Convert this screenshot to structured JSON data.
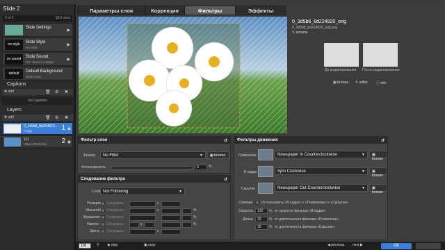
{
  "left": {
    "slide_title": "Slide 2",
    "slide_count": "2 of 2",
    "slide_duration": "10.0 secs",
    "buttons": [
      {
        "thumb": "",
        "title": "Slide Settings",
        "sub": ""
      },
      {
        "thumb": "no style",
        "title": "Slide Style",
        "sub": "No Style"
      },
      {
        "thumb": "no sound",
        "title": "Slide Sound",
        "sub": "Нет звука в слайде"
      },
      {
        "thumb": "default",
        "title": "Default Background",
        "sub": "Solid Color"
      }
    ],
    "captions_title": "Captions",
    "captions_add": "add",
    "no_captions": "No Captions",
    "layers_title": "Layers",
    "layers_add": "add",
    "layers": [
      {
        "name": "0_3d5b8_8d224820...",
        "type": "Image",
        "num": "1"
      },
      {
        "name": "111",
        "type": "Video (00:00:01)",
        "num": "2"
      }
    ]
  },
  "tabs": [
    "Параметры слоя",
    "Коррекция",
    "Фильтры",
    "Эффекты"
  ],
  "info": {
    "filename": "0_3d5b8_8d224820_orig",
    "filetype": "0_3d5b8_8d224820_orig.png",
    "rename": "rename",
    "before": "До редактирования",
    "after": "После редактирования",
    "browse": "browse",
    "editor": "editor",
    "info": "info"
  },
  "filter_layer": {
    "title": "Фильтр слоя",
    "filter_label": "Фильтр",
    "filter_value": "No Filter",
    "browse": "browse",
    "intensity_label": "Интенсивность",
    "intensity_value": "0"
  },
  "follow": {
    "title": "Следование фильтра",
    "layer_label": "Слой",
    "layer_value": "Not Following",
    "rows": [
      {
        "label": "Позиция",
        "mode": "Следовать"
      },
      {
        "label": "Масштаб",
        "mode": "Следовать"
      },
      {
        "label": "Вращение",
        "mode": "Следовать"
      },
      {
        "label": "Наклон",
        "mode": "Следовать"
      },
      {
        "label": "Центр",
        "mode": "Следовать"
      }
    ]
  },
  "motion": {
    "title": "Фильтры движения",
    "rows": [
      {
        "label": "Появление",
        "value": "Newspaper In Counterclockwise",
        "browse": "browse"
      },
      {
        "label": "В кадре",
        "value": "Spin Clockwise",
        "browse": "browse"
      },
      {
        "label": "Скрытие",
        "value": "Newspaper Out Counterclockwise",
        "browse": "browse"
      }
    ],
    "merge_label": "Слияние",
    "merge_text": "Использовать «В кадре» с «Появление» и «Скрытие»",
    "speed_label": "Скорость",
    "speed_value": "100",
    "speed_text": "от скорости фильтра «В кадре»",
    "length_label": "Длина",
    "length_in": "30",
    "length_in_text": "от длительности фильтра «Появление»",
    "length_out": "30",
    "length_out_text": "от длительности фильтра «Скрытие»"
  },
  "bottom": {
    "zoom": "100",
    "play": "play",
    "copy": "copy",
    "previous": "previous",
    "next": "next",
    "ok": "Ok"
  }
}
